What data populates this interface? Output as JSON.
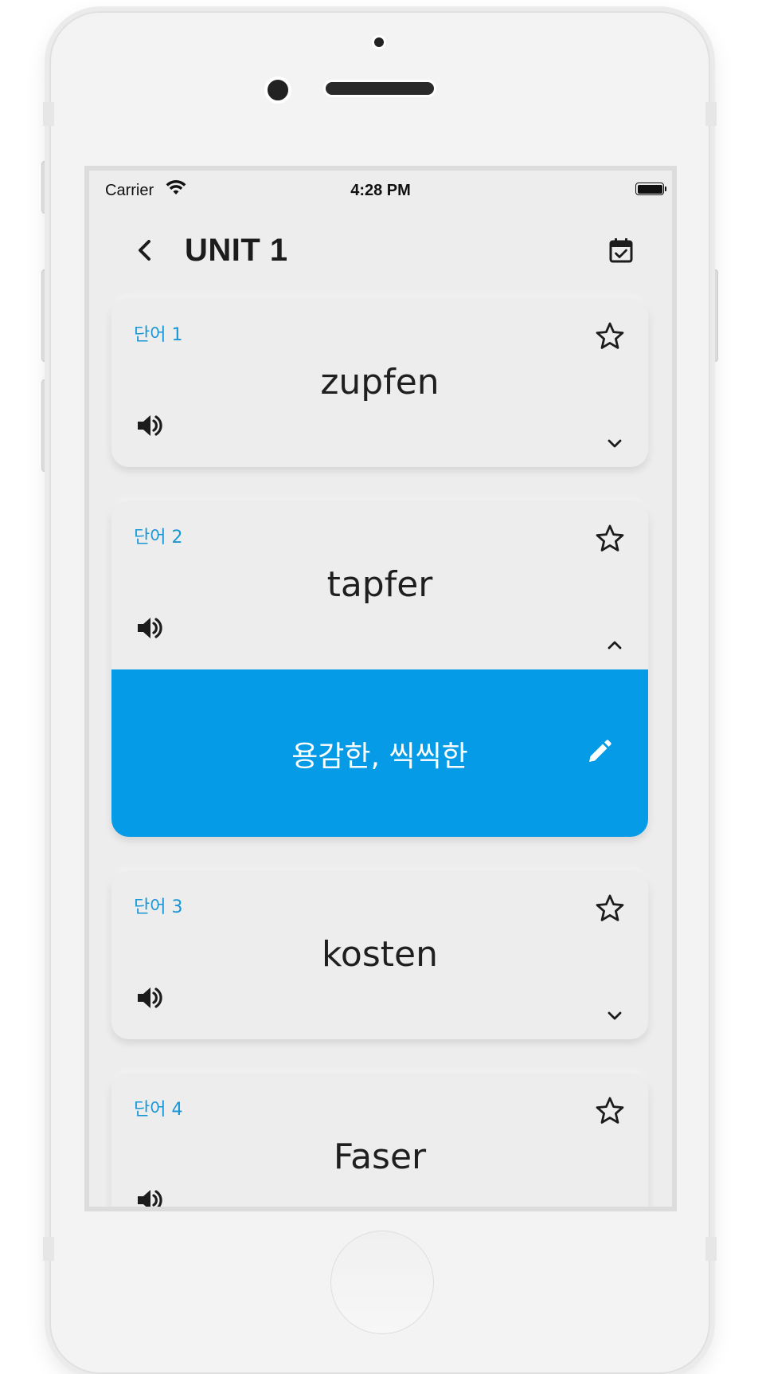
{
  "status_bar": {
    "carrier": "Carrier",
    "time": "4:28 PM"
  },
  "header": {
    "title": "UNIT 1"
  },
  "cards": [
    {
      "label": "단어 1",
      "word": "zupfen",
      "expanded": false
    },
    {
      "label": "단어 2",
      "word": "tapfer",
      "expanded": true,
      "meaning": "용감한, 씩씩한"
    },
    {
      "label": "단어 3",
      "word": "kosten",
      "expanded": false
    },
    {
      "label": "단어 4",
      "word": "Faser",
      "expanded": false
    }
  ],
  "icons": {
    "back": "chevron-left-icon",
    "calendar": "calendar-check-icon",
    "star": "star-outline-icon",
    "speaker": "volume-icon",
    "expand": "chevron-down-icon",
    "collapse": "chevron-up-icon",
    "edit": "pencil-icon"
  },
  "colors": {
    "accent": "#069be6",
    "label": "#1a96d6",
    "background": "#ededed",
    "text": "#1f1f1f"
  }
}
